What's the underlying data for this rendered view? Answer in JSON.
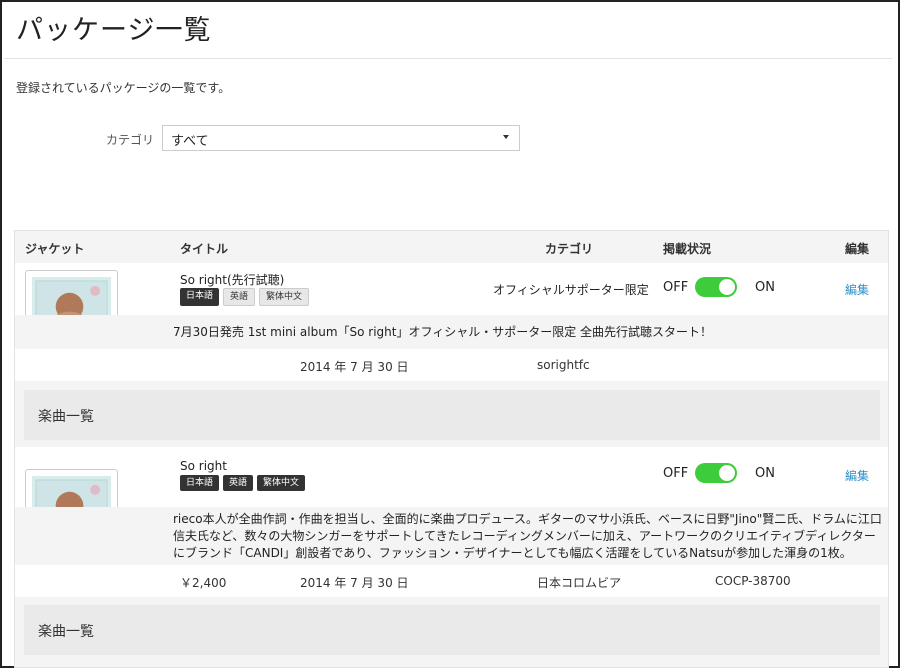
{
  "page": {
    "title": "パッケージ一覧",
    "lead": "登録されているパッケージの一覧です。"
  },
  "filter": {
    "label": "カテゴリ",
    "selected": "すべて"
  },
  "table": {
    "headers": {
      "jacket": "ジャケット",
      "title": "タイトル",
      "category": "カテゴリ",
      "status": "掲載状況",
      "edit": "編集"
    },
    "rows": [
      {
        "title": "So right(先行試聴)",
        "tags": [
          "日本語",
          "英語",
          "繁体中文"
        ],
        "category": "オフィシャルサポーター限定",
        "off_label": "OFF",
        "on_label": "ON",
        "status_on": true,
        "edit_label": "編集",
        "description": "7月30日発売 1st mini album「So right」オフィシャル・サポーター限定 全曲先行試聴スタート！",
        "price": "",
        "date": "2014 年 7 月 30 日",
        "label": "sorightfc",
        "code": "",
        "tracks_label": "楽曲一覧"
      },
      {
        "title": "So right",
        "tags": [
          "日本語",
          "英語",
          "繁体中文"
        ],
        "category": "",
        "off_label": "OFF",
        "on_label": "ON",
        "status_on": true,
        "edit_label": "編集",
        "description": "rieco本人が全曲作詞・作曲を担当し、全面的に楽曲プロデュース。ギターのマサ小浜氏、ベースに日野\"Jino\"賢二氏、ドラムに江口信夫氏など、数々の大物シンガーをサポートしてきたレコーディングメンバーに加え、アートワークのクリエイティブディレクターにブランド「CANDI」創設者であり、ファッション・デザイナーとしても幅広く活躍をしているNatsuが参加した渾身の1枚。",
        "price": "￥2,400",
        "date": "2014 年 7 月 30 日",
        "label": "日本コロムビア",
        "code": "COCP-38700",
        "tracks_label": "楽曲一覧"
      }
    ]
  },
  "colors": {
    "toggle_on": "#3ccc3c",
    "link": "#2a8fc8"
  },
  "icons": {
    "select_caret": "caret-down-icon"
  }
}
